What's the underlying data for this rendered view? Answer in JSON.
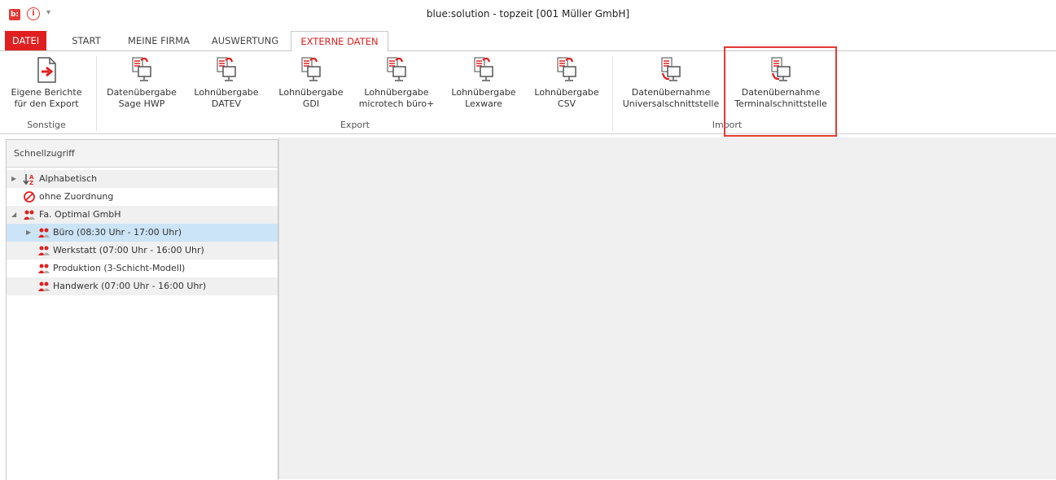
{
  "titlebar": {
    "app_icon": "b:",
    "title": "blue:solution - topzeit [001 Müller GmbH]"
  },
  "tabs": [
    {
      "label": "DATEI"
    },
    {
      "label": "START"
    },
    {
      "label": "MEINE FIRMA"
    },
    {
      "label": "AUSWERTUNG"
    },
    {
      "label": "EXTERNE DATEN"
    }
  ],
  "active_tab": "EXTERNE DATEN",
  "ribbon": {
    "groups": [
      {
        "label": "Sonstige",
        "buttons": [
          {
            "line1": "Eigene Berichte",
            "line2": "für den Export",
            "icon": "report-export-icon"
          }
        ]
      },
      {
        "label": "Export",
        "buttons": [
          {
            "line1": "Datenübergabe",
            "line2": "Sage HWP",
            "icon": "data-export-icon"
          },
          {
            "line1": "Lohnübergabe",
            "line2": "DATEV",
            "icon": "data-export-icon"
          },
          {
            "line1": "Lohnübergabe",
            "line2": "GDI",
            "icon": "data-export-icon"
          },
          {
            "line1": "Lohnübergabe",
            "line2": "microtech büro+",
            "icon": "data-export-icon"
          },
          {
            "line1": "Lohnübergabe",
            "line2": "Lexware",
            "icon": "data-export-icon"
          },
          {
            "line1": "Lohnübergabe",
            "line2": "CSV",
            "icon": "data-export-icon"
          }
        ]
      },
      {
        "label": "Import",
        "buttons": [
          {
            "line1": "Datenübernahme",
            "line2": "Universalschnittstelle",
            "icon": "data-import-icon"
          },
          {
            "line1": "Datenübernahme",
            "line2": "Terminalschnittstelle",
            "icon": "data-import-icon"
          }
        ]
      }
    ]
  },
  "quick_access": {
    "header": "Schnellzugriff",
    "items": [
      {
        "label": "Alphabetisch",
        "icon": "sort-az-icon"
      },
      {
        "label": "ohne Zuordnung",
        "icon": "no-assignment-icon"
      },
      {
        "label": "Fa. Optimal GmbH",
        "icon": "group-icon"
      },
      {
        "label": "Büro (08:30 Uhr - 17:00 Uhr)",
        "icon": "group-icon"
      },
      {
        "label": "Werkstatt (07:00 Uhr - 16:00 Uhr)",
        "icon": "group-icon"
      },
      {
        "label": "Produktion (3-Schicht-Modell)",
        "icon": "group-icon"
      },
      {
        "label": "Handwerk (07:00 Uhr - 16:00 Uhr)",
        "icon": "group-icon"
      }
    ]
  },
  "colors": {
    "accent": "#e02020",
    "selection": "#cce4f7",
    "highlight_box": "#e53935"
  }
}
